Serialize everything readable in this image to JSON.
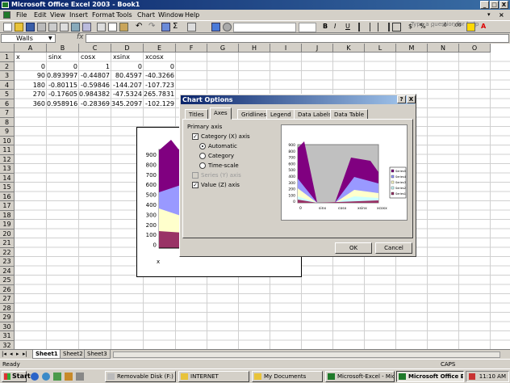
{
  "window": {
    "title": "Microsoft Office Excel 2003 - Book1",
    "controls": [
      "_",
      "□",
      "X"
    ]
  },
  "menu": {
    "items": [
      "File",
      "Edit",
      "View",
      "Insert",
      "Format",
      "Tools",
      "Chart",
      "Window",
      "Help"
    ],
    "help_placeholder": "Type a question for help"
  },
  "formula_bar": {
    "name_box": "Walls",
    "fx": "fx",
    "value": ""
  },
  "columns": [
    "A",
    "B",
    "C",
    "D",
    "E",
    "F",
    "G",
    "H",
    "I",
    "J",
    "K",
    "L",
    "M",
    "N",
    "O"
  ],
  "rows": [
    "1",
    "2",
    "3",
    "4",
    "5",
    "6",
    "7",
    "8",
    "9",
    "10",
    "11",
    "12",
    "13",
    "14",
    "15",
    "16",
    "17",
    "18",
    "19",
    "20",
    "21",
    "22",
    "23",
    "24",
    "25",
    "26",
    "27",
    "28",
    "29",
    "30",
    "31",
    "32"
  ],
  "sheet_data": {
    "headers": [
      "x",
      "sinx",
      "cosx",
      "xsinx",
      "xcosx"
    ],
    "rows": [
      [
        "0",
        "0",
        "1",
        "0",
        "0"
      ],
      [
        "90",
        "0.893997",
        "-0.44807",
        "80.4597",
        "-40.3266"
      ],
      [
        "180",
        "-0.80115",
        "-0.59846",
        "-144.207",
        "-107.723"
      ],
      [
        "270",
        "-0.17605",
        "0.984382",
        "-47.5324",
        "265.7831"
      ],
      [
        "360",
        "0.958916",
        "-0.28369",
        "345.2097",
        "-102.129"
      ]
    ]
  },
  "embedded_chart": {
    "y_ticks": [
      "900",
      "800",
      "700",
      "600",
      "500",
      "400",
      "300",
      "200",
      "100",
      "0"
    ],
    "x_label": "x"
  },
  "dialog": {
    "title": "Chart Options",
    "help": "?",
    "close": "X",
    "tabs": [
      "Titles",
      "Axes",
      "Gridlines",
      "Legend",
      "Data Labels",
      "Data Table"
    ],
    "selected_tab": "Axes",
    "group_label": "Primary axis",
    "category_axis": {
      "label": "Category (X) axis",
      "checked": true
    },
    "radio_options": [
      {
        "label": "Automatic",
        "selected": true
      },
      {
        "label": "Category",
        "selected": false
      },
      {
        "label": "Time-scale",
        "selected": false
      }
    ],
    "series_axis": {
      "label": "Series (Y) axis",
      "checked": false,
      "disabled": true
    },
    "value_axis": {
      "label": "Value (Z) axis",
      "checked": true
    },
    "ok_label": "OK",
    "cancel_label": "Cancel",
    "preview": {
      "y_ticks": [
        "900",
        "800",
        "700",
        "600",
        "500",
        "400",
        "300",
        "200",
        "100",
        "0"
      ],
      "x_ticks": [
        "0",
        "sinx",
        "cosx",
        "xsinx",
        "xcosx"
      ],
      "legend": [
        "Series5",
        "Series4",
        "Series3",
        "Series2",
        "Series1"
      ]
    }
  },
  "sheet_tabs": [
    "Sheet1",
    "Sheet2",
    "Sheet3"
  ],
  "status": {
    "left": "Ready",
    "caps": "CAPS"
  },
  "taskbar": {
    "start": "Start",
    "buttons": [
      "Removable Disk (F:)",
      "INTERNET",
      "My Documents",
      "Microsoft-Excel - Micr...",
      "Microsoft Office Exc..."
    ],
    "clock": "11:10 AM"
  },
  "colors": {
    "accent": "#0a246a",
    "series_purple": "#800080",
    "series_maroon": "#993366",
    "series_yellow": "#ffffcc",
    "series_cyan": "#ccffff",
    "series_lavender": "#9999ff"
  }
}
